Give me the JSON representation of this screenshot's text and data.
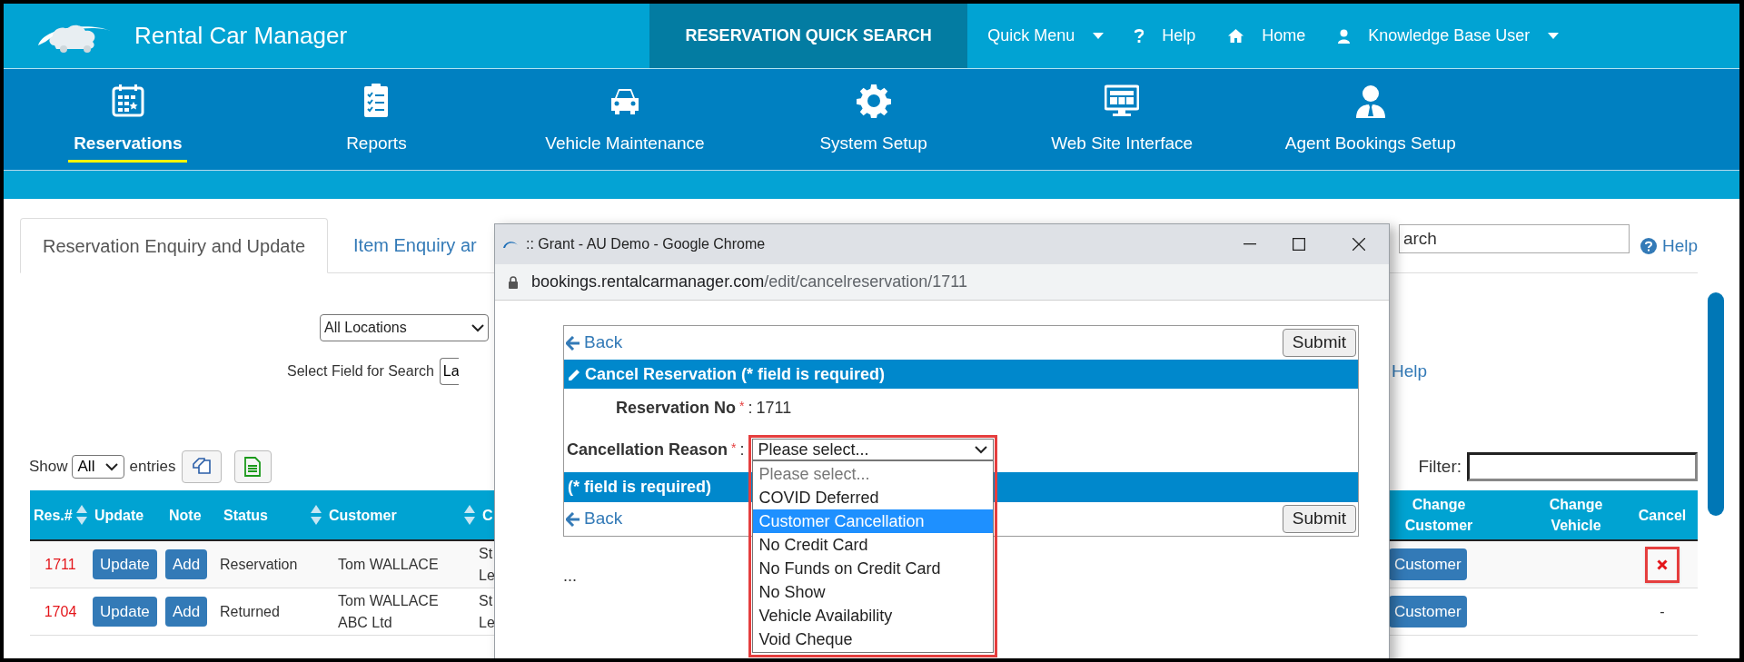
{
  "app": {
    "title": "Rental Car Manager"
  },
  "top_menu": [
    {
      "label": "RESERVATION QUICK SEARCH",
      "kind": "panel"
    },
    {
      "label": "Quick Menu",
      "kind": "dropdown"
    },
    {
      "label": "Help",
      "kind": "link"
    },
    {
      "label": "Home",
      "kind": "link"
    },
    {
      "label": "Knowledge Base User",
      "kind": "dropdown"
    }
  ],
  "modules": [
    {
      "label": "Reservations",
      "selected": true
    },
    {
      "label": "Reports",
      "selected": false
    },
    {
      "label": "Vehicle Maintenance",
      "selected": false
    },
    {
      "label": "System Setup",
      "selected": false
    },
    {
      "label": "Web Site Interface",
      "selected": false
    },
    {
      "label": "Agent Bookings Setup",
      "selected": false
    }
  ],
  "tabs": [
    {
      "label": "Reservation Enquiry and Update",
      "selected": true
    },
    {
      "label": "Item Enquiry ar",
      "selected": false
    }
  ],
  "search": {
    "placeholder": "arch"
  },
  "help_links": [
    "Help",
    "Help"
  ],
  "location_select": {
    "value": "All Locations"
  },
  "field_select": {
    "label": "Select Field for Search",
    "value": "La"
  },
  "entries": {
    "before": "Show",
    "value": "All",
    "after": "entries"
  },
  "filter": {
    "label": "Filter:"
  },
  "table": {
    "columns": [
      {
        "label": "Res.#",
        "sortable": true
      },
      {
        "label": "Update",
        "sortable": false
      },
      {
        "label": "Note",
        "sortable": false
      },
      {
        "label": "Status",
        "sortable": true
      },
      {
        "label": "Customer",
        "sortable": true
      },
      {
        "label": "C"
      },
      {
        "label": "Change Customer",
        "sortable": false
      },
      {
        "label": "Change Vehicle",
        "sortable": false
      },
      {
        "label": "Cancel",
        "sortable": false
      }
    ],
    "rows": [
      {
        "res_no": "1711",
        "update": "Update",
        "note": "Add",
        "status": "Reservation",
        "customer": [
          "Tom WALLACE"
        ],
        "column_6": [
          "St",
          "Le"
        ],
        "change_customer": "Customer",
        "cancel": {
          "kind": "icon",
          "highlighted": true
        }
      },
      {
        "res_no": "1704",
        "update": "Update",
        "note": "Add",
        "status": "Returned",
        "customer": [
          "Tom WALLACE",
          "ABC Ltd"
        ],
        "column_6": [
          "St",
          "Le"
        ],
        "change_customer": "Customer",
        "cancel": {
          "kind": "text",
          "text": "-",
          "highlighted": false
        }
      }
    ]
  },
  "popup": {
    "title": ":: Grant - AU Demo - Google Chrome",
    "url_host": "bookings.rentalcarmanager.com",
    "url_path": "/edit/cancelreservation/1711",
    "back": "Back",
    "submit": "Submit",
    "heading": "Cancel Reservation (* field is required)",
    "reservation_label": "Reservation No",
    "required_mark": "*",
    "separator": ":",
    "reservation_no": "1711",
    "reason_label": "Cancellation Reason",
    "reason_value": "Please select...",
    "options": [
      {
        "label": "Please select...",
        "kind": "placeholder",
        "selected": false
      },
      {
        "label": "COVID Deferred",
        "kind": "option",
        "selected": false
      },
      {
        "label": "Customer Cancellation",
        "kind": "option",
        "selected": true
      },
      {
        "label": "No Credit Card",
        "kind": "option",
        "selected": false
      },
      {
        "label": "No Funds on Credit Card",
        "kind": "option",
        "selected": false
      },
      {
        "label": "No Show",
        "kind": "option",
        "selected": false
      },
      {
        "label": "Vehicle Availability",
        "kind": "option",
        "selected": false
      },
      {
        "label": "Void Cheque",
        "kind": "option",
        "selected": false
      }
    ],
    "footer_note": "(* field is required)",
    "back_2": "Back",
    "submit_2": "Submit",
    "ellipsis": "..."
  }
}
